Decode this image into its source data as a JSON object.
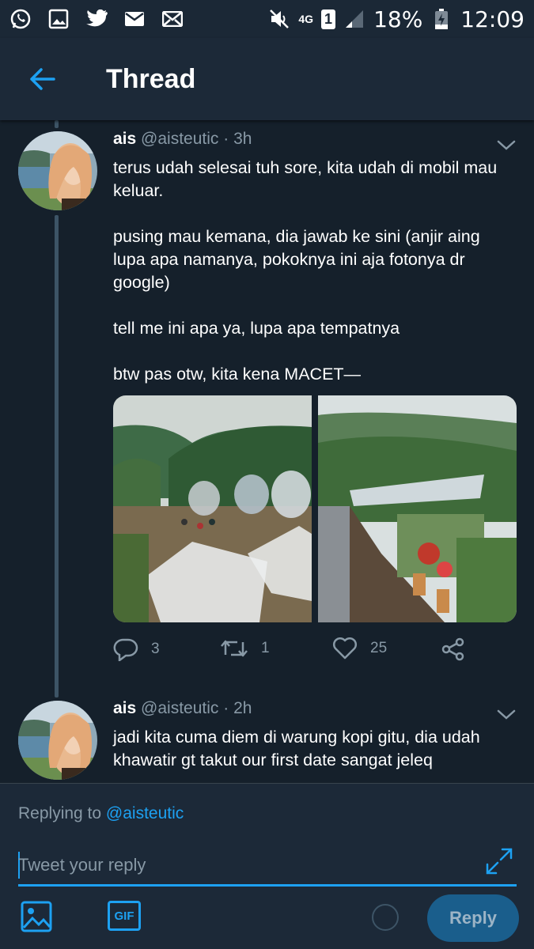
{
  "status_bar": {
    "network": "4G",
    "sim": "1",
    "battery": "18%",
    "time": "12:09"
  },
  "header": {
    "title": "Thread"
  },
  "tweets": [
    {
      "name": "ais",
      "handle": "@aisteutic",
      "time": "· 3h",
      "paragraphs": [
        "terus udah selesai tuh sore, kita udah di mobil mau keluar.",
        "pusing mau kemana, dia jawab ke sini (anjir aing lupa apa namanya, pokoknya ini aja fotonya dr google)",
        "tell me ini apa ya, lupa apa tempatnya",
        "btw pas otw, kita kena MACET—"
      ],
      "actions": {
        "replies": "3",
        "retweets": "1",
        "likes": "25"
      }
    },
    {
      "name": "ais",
      "handle": "@aisteutic",
      "time": "· 2h",
      "paragraphs": [
        "jadi kita cuma diem di warung kopi gitu, dia udah khawatir gt takut our first date sangat jeleq"
      ]
    }
  ],
  "composer": {
    "replying_prefix": "Replying to",
    "replying_to": "@aisteutic",
    "placeholder": "Tweet your reply",
    "gif_label": "GIF",
    "reply_button": "Reply"
  },
  "colors": {
    "background": "#15202b",
    "accent": "#1da1f2",
    "muted": "#8899a6"
  }
}
